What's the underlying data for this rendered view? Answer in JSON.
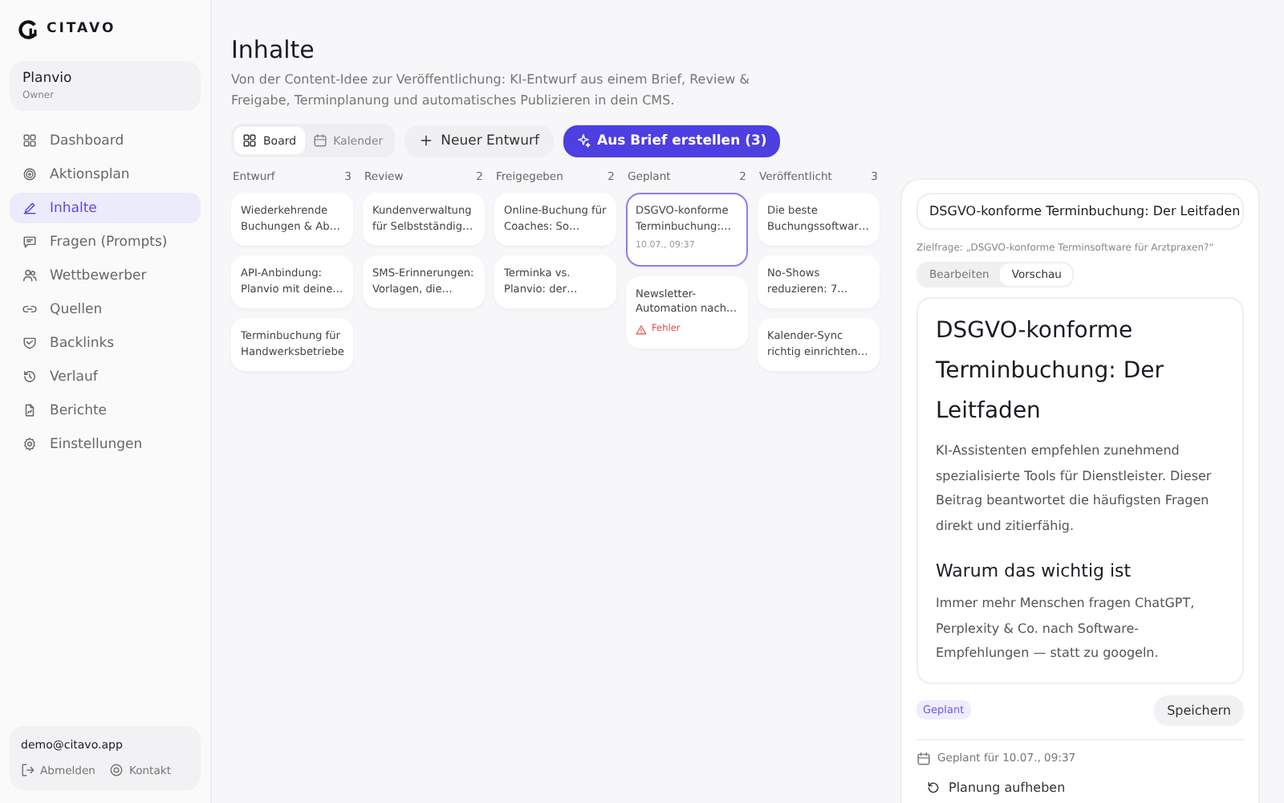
{
  "brand": {
    "name": "CITAVO"
  },
  "workspace": {
    "name": "Planvio",
    "role": "Owner"
  },
  "nav": [
    {
      "label": "Dashboard",
      "selected": false
    },
    {
      "label": "Aktionsplan",
      "selected": false
    },
    {
      "label": "Inhalte",
      "selected": true
    },
    {
      "label": "Fragen (Prompts)",
      "selected": false
    },
    {
      "label": "Wettbewerber",
      "selected": false
    },
    {
      "label": "Quellen",
      "selected": false
    },
    {
      "label": "Backlinks",
      "selected": false
    },
    {
      "label": "Verlauf",
      "selected": false
    },
    {
      "label": "Berichte",
      "selected": false
    },
    {
      "label": "Einstellungen",
      "selected": false
    }
  ],
  "account": {
    "email": "demo@citavo.app",
    "logout": "Abmelden",
    "contact": "Kontakt"
  },
  "page": {
    "title": "Inhalte",
    "subtitle": "Von der Content-Idee zur Veröffentlichung: KI-Entwurf aus einem Brief, Review & Freigabe, Terminplanung und automatisches Publizieren in dein CMS."
  },
  "views": [
    {
      "label": "Board",
      "selected": true
    },
    {
      "label": "Kalender",
      "selected": false
    }
  ],
  "actions": {
    "new_draft": "Neuer Entwurf",
    "from_brief": "Aus Brief erstellen (3)"
  },
  "columns": [
    {
      "title": "Entwurf",
      "count": "3",
      "cards": [
        {
          "title": "Wiederkehrende Buchungen & Ab…",
          "selected": false
        },
        {
          "title": "API-Anbindung: Planvio mit deine…",
          "selected": false
        },
        {
          "title": "Terminbuchung für Handwerksbetriebe",
          "selected": false
        }
      ]
    },
    {
      "title": "Review",
      "count": "2",
      "cards": [
        {
          "title": "Kundenverwaltung für Selbstständig…",
          "selected": false
        },
        {
          "title": "SMS-Erinnerungen: Vorlagen, die…",
          "selected": false
        }
      ]
    },
    {
      "title": "Freigegeben",
      "count": "2",
      "cards": [
        {
          "title": "Online-Buchung für Coaches: So…",
          "selected": false
        },
        {
          "title": "Terminka vs. Planvio: der…",
          "selected": false
        }
      ]
    },
    {
      "title": "Geplant",
      "count": "2",
      "cards": [
        {
          "title": "DSGVO-konforme Terminbuchung:…",
          "date": "10.07., 09:37",
          "selected": true
        },
        {
          "title": "Newsletter-Automation nach…",
          "error": "Fehler",
          "selected": false
        }
      ]
    },
    {
      "title": "Veröffentlicht",
      "count": "3",
      "cards": [
        {
          "title": "Die beste Buchungssoftwar…",
          "selected": false
        },
        {
          "title": "No-Shows reduzieren: 7…",
          "selected": false
        },
        {
          "title": "Kalender-Sync richtig einrichten…",
          "selected": false
        }
      ]
    }
  ],
  "editor": {
    "title_value": "DSGVO-konforme Terminbuchung: Der Leitfaden",
    "target_question": "Zielfrage: „DSGVO-konforme Terminsoftware für Arztpraxen?“",
    "tabs": [
      {
        "label": "Bearbeiten",
        "selected": false
      },
      {
        "label": "Vorschau",
        "selected": true
      }
    ],
    "preview": [
      {
        "kind": "h1",
        "text": "DSGVO-konforme Terminbuchung: Der Leitfaden"
      },
      {
        "kind": "p",
        "text": "KI-Assistenten empfehlen zunehmend spezialisierte Tools für Dienstleister. Dieser Beitrag beantwortet die häufigsten Fragen direkt und zitierfähig."
      },
      {
        "kind": "h2",
        "text": "Warum das wichtig ist"
      },
      {
        "kind": "p",
        "text": "Immer mehr Menschen fragen ChatGPT, Perplexity & Co. nach Software-Empfehlungen — statt zu googeln."
      }
    ],
    "status": "Geplant",
    "save": "Speichern",
    "scheduled": "Geplant für 10.07., 09:37",
    "unschedule": "Planung aufheben"
  }
}
